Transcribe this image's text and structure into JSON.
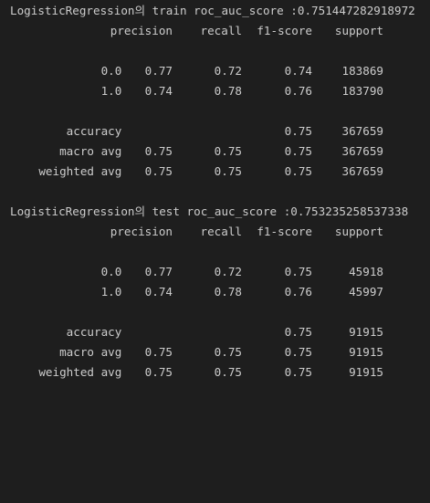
{
  "reports": [
    {
      "title": "LogisticRegression의 train roc_auc_score :0.751447282918972",
      "headers": [
        "precision",
        "recall",
        "f1-score",
        "support"
      ],
      "class_rows": [
        {
          "label": "0.0",
          "precision": "0.77",
          "recall": "0.72",
          "f1": "0.74",
          "support": "183869"
        },
        {
          "label": "1.0",
          "precision": "0.74",
          "recall": "0.78",
          "f1": "0.76",
          "support": "183790"
        }
      ],
      "accuracy": {
        "label": "accuracy",
        "f1": "0.75",
        "support": "367659"
      },
      "avg_rows": [
        {
          "label": "macro avg",
          "precision": "0.75",
          "recall": "0.75",
          "f1": "0.75",
          "support": "367659"
        },
        {
          "label": "weighted avg",
          "precision": "0.75",
          "recall": "0.75",
          "f1": "0.75",
          "support": "367659"
        }
      ]
    },
    {
      "title": "LogisticRegression의 test roc_auc_score :0.753235258537338",
      "headers": [
        "precision",
        "recall",
        "f1-score",
        "support"
      ],
      "class_rows": [
        {
          "label": "0.0",
          "precision": "0.77",
          "recall": "0.72",
          "f1": "0.75",
          "support": "45918"
        },
        {
          "label": "1.0",
          "precision": "0.74",
          "recall": "0.78",
          "f1": "0.76",
          "support": "45997"
        }
      ],
      "accuracy": {
        "label": "accuracy",
        "f1": "0.75",
        "support": "91915"
      },
      "avg_rows": [
        {
          "label": "macro avg",
          "precision": "0.75",
          "recall": "0.75",
          "f1": "0.75",
          "support": "91915"
        },
        {
          "label": "weighted avg",
          "precision": "0.75",
          "recall": "0.75",
          "f1": "0.75",
          "support": "91915"
        }
      ]
    }
  ]
}
